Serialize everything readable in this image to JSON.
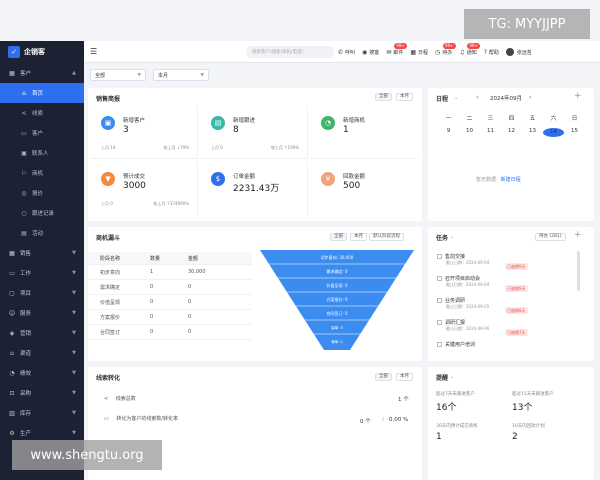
{
  "brand": {
    "name": "企销客"
  },
  "sidebar": {
    "groups": [
      {
        "label": "客户",
        "icon": "grid-icon",
        "expanded": true
      },
      {
        "label": "销售",
        "icon": "grid-icon"
      },
      {
        "label": "工作",
        "icon": "folder-icon"
      },
      {
        "label": "项目",
        "icon": "box-icon"
      },
      {
        "label": "服务",
        "icon": "service-icon"
      },
      {
        "label": "营销",
        "icon": "marketing-icon"
      },
      {
        "label": "渠道",
        "icon": "channel-icon"
      },
      {
        "label": "绩效",
        "icon": "chart-icon"
      },
      {
        "label": "采购",
        "icon": "cart-icon"
      },
      {
        "label": "库存",
        "icon": "stock-icon"
      },
      {
        "label": "生产",
        "icon": "factory-icon"
      }
    ],
    "subitems": [
      {
        "label": "首页",
        "active": true
      },
      {
        "label": "线索"
      },
      {
        "label": "客户"
      },
      {
        "label": "联系人"
      },
      {
        "label": "商机"
      },
      {
        "label": "报价"
      },
      {
        "label": "跟进记录"
      },
      {
        "label": "活动"
      }
    ]
  },
  "topbar": {
    "search_placeholder": "搜索客户/线索/商机/电话/...",
    "actions": [
      {
        "label": "呼叫",
        "icon": "phone-icon"
      },
      {
        "label": "搜客",
        "icon": "location-icon"
      },
      {
        "label": "邮件",
        "icon": "mail-icon",
        "badge": "99+"
      },
      {
        "label": "日程",
        "icon": "calendar-icon"
      },
      {
        "label": "待办",
        "icon": "clock-icon",
        "badge": "99+"
      },
      {
        "label": "通知",
        "icon": "bell-icon",
        "badge": "99+"
      },
      {
        "label": "帮助",
        "icon": "help-icon"
      }
    ],
    "user_name": "张远哲"
  },
  "filters": {
    "scope": "全部",
    "period": "本月"
  },
  "sales_brief": {
    "title": "销售简报",
    "pills": [
      "全部",
      "本月"
    ],
    "kpis": [
      {
        "label": "新增客户",
        "value": "3",
        "foot_l": "上月 14",
        "foot_r": "较上月 ↓79%",
        "color": "#3c8cf0",
        "icon": "customer-icon"
      },
      {
        "label": "新增跟进",
        "value": "8",
        "foot_l": "上月 0",
        "foot_r": "较上月 ↑100%",
        "color": "#38b8a8",
        "icon": "followup-icon"
      },
      {
        "label": "新增商机",
        "value": "1",
        "foot_l": "",
        "foot_r": "",
        "color": "#3fb56a",
        "icon": "opportunity-icon"
      },
      {
        "label": "预计成交",
        "value": "3000",
        "foot_l": "上月 0",
        "foot_r": "较上月 ↑374900%",
        "color": "#f08a3c",
        "icon": "deal-icon"
      },
      {
        "label": "订单金额",
        "value": "2231.43万",
        "foot_l": "",
        "foot_r": "",
        "color": "#2e6ff2",
        "icon": "order-icon"
      },
      {
        "label": "回款金额",
        "value": "500",
        "foot_l": "",
        "foot_r": "",
        "color": "#f0a37c",
        "icon": "payment-icon"
      }
    ]
  },
  "calendar": {
    "title": "日程",
    "month": "2024年09月",
    "weekdays": [
      "一",
      "二",
      "三",
      "四",
      "五",
      "六",
      "日"
    ],
    "days": [
      "9",
      "10",
      "11",
      "12",
      "13",
      "14",
      "15"
    ],
    "today": "14",
    "empty_text": "暂无数据",
    "new_link": "新建日程"
  },
  "funnel": {
    "title": "商机漏斗",
    "pills": [
      "全部",
      "本月",
      "默认阶段流程"
    ],
    "headers": [
      "阶段名称",
      "数量",
      "金额"
    ],
    "rows": [
      {
        "stage": "初步意向",
        "count": "1",
        "amount": "30,000"
      },
      {
        "stage": "需求确定",
        "count": "0",
        "amount": "0"
      },
      {
        "stage": "价值呈现",
        "count": "0",
        "amount": "0"
      },
      {
        "stage": "方案报价",
        "count": "0",
        "amount": "0"
      },
      {
        "stage": "合同签订",
        "count": "0",
        "amount": "0"
      }
    ],
    "bands": [
      "初步意向: 30,000",
      "需求确定: 0",
      "价值呈现: 0",
      "方案报价: 0",
      "合同签订: 0",
      "赢单: 0",
      "输单: 0"
    ]
  },
  "tasks": {
    "title": "任务",
    "filter": "待办 (281)",
    "items": [
      {
        "name": "售前交接",
        "sub": "截止日期：2024-09-04",
        "tag": "已逾期9天"
      },
      {
        "name": "召开项目启动会",
        "sub": "截止日期：2024-09-04",
        "tag": "已逾期9天"
      },
      {
        "name": "业务调研",
        "sub": "截止日期：2024-09-05",
        "tag": "已逾期8天"
      },
      {
        "name": "调研汇报",
        "sub": "截止日期：2024-09-06",
        "tag": "已逾期7天"
      },
      {
        "name": "关键用户培训",
        "sub": "",
        "tag": ""
      }
    ]
  },
  "leads": {
    "title": "线索转化",
    "pills": [
      "全部",
      "本月"
    ],
    "rows": [
      {
        "label": "线索总数",
        "value": "1 个"
      },
      {
        "label": "转化为客户的线索数/转化率",
        "value": "0 个",
        "rate": "0.00 %"
      }
    ]
  },
  "reminders": {
    "title": "提醒",
    "items": [
      {
        "label": "超过7天未跟进客户",
        "value": "16个"
      },
      {
        "label": "超过15天未跟进客户",
        "value": "13个"
      },
      {
        "label": "30天内预计成交商机",
        "value": "1"
      },
      {
        "label": "10天内回款计划",
        "value": "2"
      }
    ]
  },
  "watermarks": {
    "top": "TG: MYYJJPP",
    "bottom": "www.shengtu.org"
  }
}
